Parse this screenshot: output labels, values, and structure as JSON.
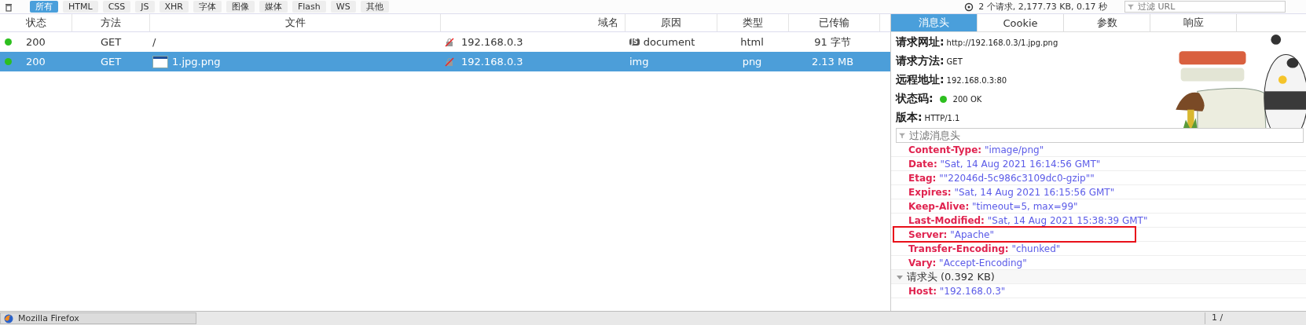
{
  "toolbar": {
    "filters": [
      {
        "label": "所有",
        "selected": true
      },
      {
        "label": "HTML",
        "selected": false
      },
      {
        "label": "CSS",
        "selected": false
      },
      {
        "label": "JS",
        "selected": false
      },
      {
        "label": "XHR",
        "selected": false
      },
      {
        "label": "字体",
        "selected": false
      },
      {
        "label": "图像",
        "selected": false
      },
      {
        "label": "媒体",
        "selected": false
      },
      {
        "label": "Flash",
        "selected": false
      },
      {
        "label": "WS",
        "selected": false
      },
      {
        "label": "其他",
        "selected": false
      }
    ],
    "summary": "2 个请求, 2,177.73 KB, 0.17 秒",
    "filter_placeholder": "过滤 URL"
  },
  "table": {
    "columns": [
      "状态",
      "方法",
      "文件",
      "域名",
      "原因",
      "类型",
      "已传输"
    ],
    "rows": [
      {
        "selected": false,
        "status": "200",
        "method": "GET",
        "file": "/",
        "file_thumbnail": false,
        "domain": "192.168.0.3",
        "cause_badge": "JS",
        "cause": "document",
        "type": "html",
        "transferred": "91 字节"
      },
      {
        "selected": true,
        "status": "200",
        "method": "GET",
        "file": "1.jpg.png",
        "file_thumbnail": true,
        "domain": "192.168.0.3",
        "cause": "img",
        "type": "png",
        "transferred": "2.13 MB"
      }
    ]
  },
  "details": {
    "tabs": [
      {
        "label": "消息头",
        "selected": true
      },
      {
        "label": "Cookie",
        "selected": false
      },
      {
        "label": "参数",
        "selected": false
      },
      {
        "label": "响应",
        "selected": false
      }
    ],
    "summary": [
      {
        "label": "请求网址:",
        "value": "http://192.168.0.3/1.jpg.png"
      },
      {
        "label": "请求方法:",
        "value": "GET"
      },
      {
        "label": "远程地址:",
        "value": "192.168.0.3:80"
      },
      {
        "label": "状态码:",
        "value": "200 OK",
        "kind": "status"
      },
      {
        "label": "版本:",
        "value": "HTTP/1.1"
      }
    ],
    "filter_placeholder": "过滤消息头",
    "headers": [
      {
        "kind": "header",
        "name": "Content-Type:",
        "value": "\"image/png\"",
        "highlighted": false
      },
      {
        "kind": "header",
        "name": "Date:",
        "value": "\"Sat, 14 Aug 2021 16:14:56 GMT\"",
        "highlighted": false
      },
      {
        "kind": "header",
        "name": "Etag:",
        "value": "\"\"22046d-5c986c3109dc0-gzip\"\"",
        "highlighted": false
      },
      {
        "kind": "header",
        "name": "Expires:",
        "value": "\"Sat, 14 Aug 2021 16:15:56 GMT\"",
        "highlighted": false
      },
      {
        "kind": "header",
        "name": "Keep-Alive:",
        "value": "\"timeout=5, max=99\"",
        "highlighted": false
      },
      {
        "kind": "header",
        "name": "Last-Modified:",
        "value": "\"Sat, 14 Aug 2021 15:38:39 GMT\"",
        "highlighted": false
      },
      {
        "kind": "header",
        "name": "Server:",
        "value": "\"Apache\"",
        "highlighted": true
      },
      {
        "kind": "header",
        "name": "Transfer-Encoding:",
        "value": "\"chunked\"",
        "highlighted": false
      },
      {
        "kind": "header",
        "name": "Vary:",
        "value": "\"Accept-Encoding\"",
        "highlighted": false
      },
      {
        "kind": "section",
        "name": "请求头",
        "value": "(0.392 KB)",
        "expanded": true
      },
      {
        "kind": "header",
        "name": "Host:",
        "value": "\"192.168.0.3\"",
        "highlighted": false
      }
    ]
  },
  "taskbar": {
    "window": "Mozilla Firefox",
    "pager": "1 /"
  }
}
